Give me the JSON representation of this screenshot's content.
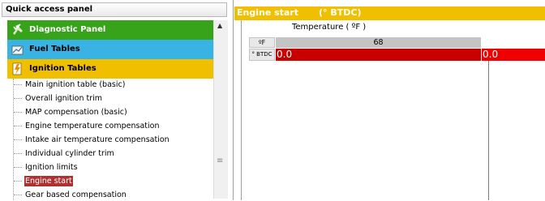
{
  "left_panel": {
    "header": "Quick access panel",
    "bands": [
      {
        "label": "Diagnostic Panel",
        "icon": "wrench-check-icon",
        "color": "#36a31b"
      },
      {
        "label": "Fuel Tables",
        "icon": "fuel-table-icon",
        "color": "#39b3e3"
      },
      {
        "label": "Ignition Tables",
        "icon": "ignition-icon",
        "color": "#f0c000"
      }
    ],
    "items": [
      "Main ignition table (basic)",
      "Overall ignition trim",
      "MAP compensation (basic)",
      "Engine temperature compensation",
      "Intake air temperature compensation",
      "Individual cylinder trim",
      "Ignition limits",
      "Engine start",
      "Gear based compensation"
    ],
    "selected_item": "Engine start"
  },
  "table": {
    "title": "Engine start",
    "unit": "(° BTDC)",
    "caption": "Temperature  ( ºF )",
    "axis_unit": "ºF",
    "row_label": "° BTDC",
    "column_value": "68",
    "cell_values": [
      "0.0",
      "0.0"
    ]
  }
}
